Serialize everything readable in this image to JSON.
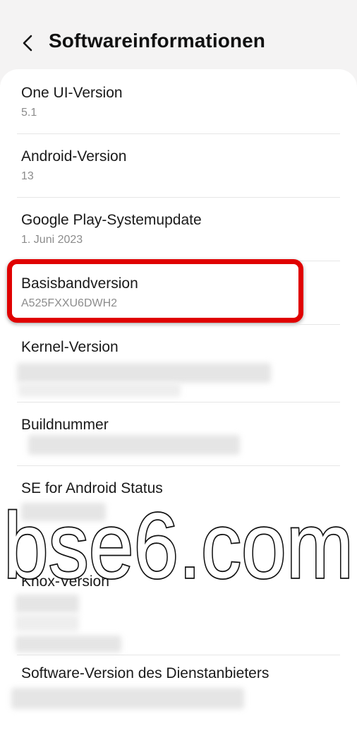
{
  "header": {
    "title": "Softwareinformationen",
    "back_icon": "chevron-left-icon"
  },
  "items": [
    {
      "label": "One UI-Version",
      "value": "5.1"
    },
    {
      "label": "Android-Version",
      "value": "13"
    },
    {
      "label": "Google Play-Systemupdate",
      "value": "1. Juni 2023"
    },
    {
      "label": "Basisbandversion",
      "value": "A525FXXU6DWH2"
    },
    {
      "label": "Kernel-Version",
      "value": ""
    },
    {
      "label": "Buildnummer",
      "value": ""
    },
    {
      "label": "SE for Android Status",
      "value": ""
    },
    {
      "label": "Knox-Version",
      "value": ""
    },
    {
      "label": "Software-Version des Dienstanbieters",
      "value": ""
    }
  ],
  "watermark": {
    "text": "bse6.com"
  },
  "colors": {
    "highlight": "#e00000",
    "background": "#f4f3f3",
    "card": "#ffffff"
  }
}
